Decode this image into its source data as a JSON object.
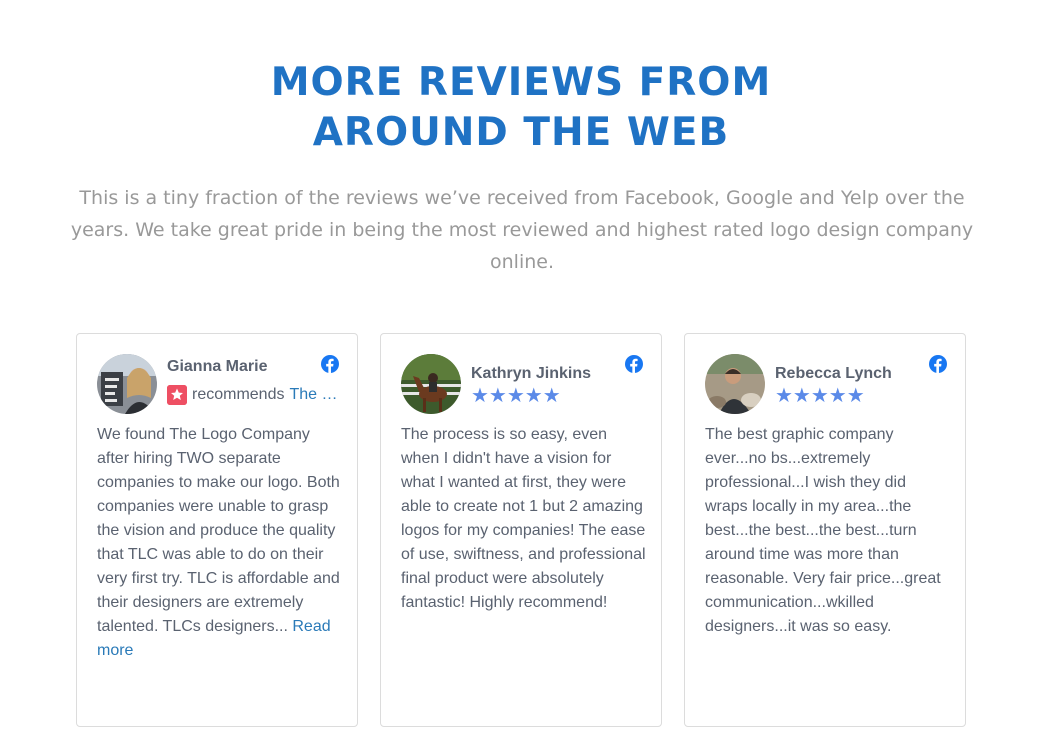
{
  "section": {
    "title_line1": "MORE REVIEWS FROM",
    "title_line2": "AROUND THE WEB",
    "description": "This is a tiny fraction of the reviews we’ve received from Facebook, Google and Yelp over the years. We take great pride in being the most reviewed and highest rated logo design company online."
  },
  "reviews": [
    {
      "name": "Gianna Marie",
      "recommends_label": "recommends",
      "recommends_target": "The Logo Company",
      "text": "We found The Logo Company after hiring TWO separate companies to make our logo. Both companies were unable to grasp the vision and produce the quality that TLC was able to do on their very first try. TLC is affordable and their designers are extremely talented. TLCs designers...",
      "read_more": "Read more",
      "source_icon": "facebook-icon"
    },
    {
      "name": "Kathryn Jinkins",
      "rating": 5,
      "stars": "★★★★★",
      "text": "The process is so easy, even when I didn't have a vision for what I wanted at first, they were able to create not 1 but 2 amazing logos for my companies! The ease of use, swiftness, and professional final product were absolutely fantastic! Highly recommend!",
      "source_icon": "facebook-icon"
    },
    {
      "name": "Rebecca Lynch",
      "rating": 5,
      "stars": "★★★★★",
      "text": "The best graphic company ever...no bs...extremely professional...I wish they did wraps locally in my area...the best...the best...the best...turn around time was more than reasonable. Very fair price...great communication...wkilled designers...it was so easy.",
      "source_icon": "facebook-icon"
    }
  ],
  "colors": {
    "heading": "#1f72c4",
    "subtext": "#999999",
    "body_text": "#5a6270",
    "link": "#2a7ab8",
    "star": "#5b8ae8",
    "facebook": "#1877f2",
    "recommend_badge": "#ee4f63"
  }
}
